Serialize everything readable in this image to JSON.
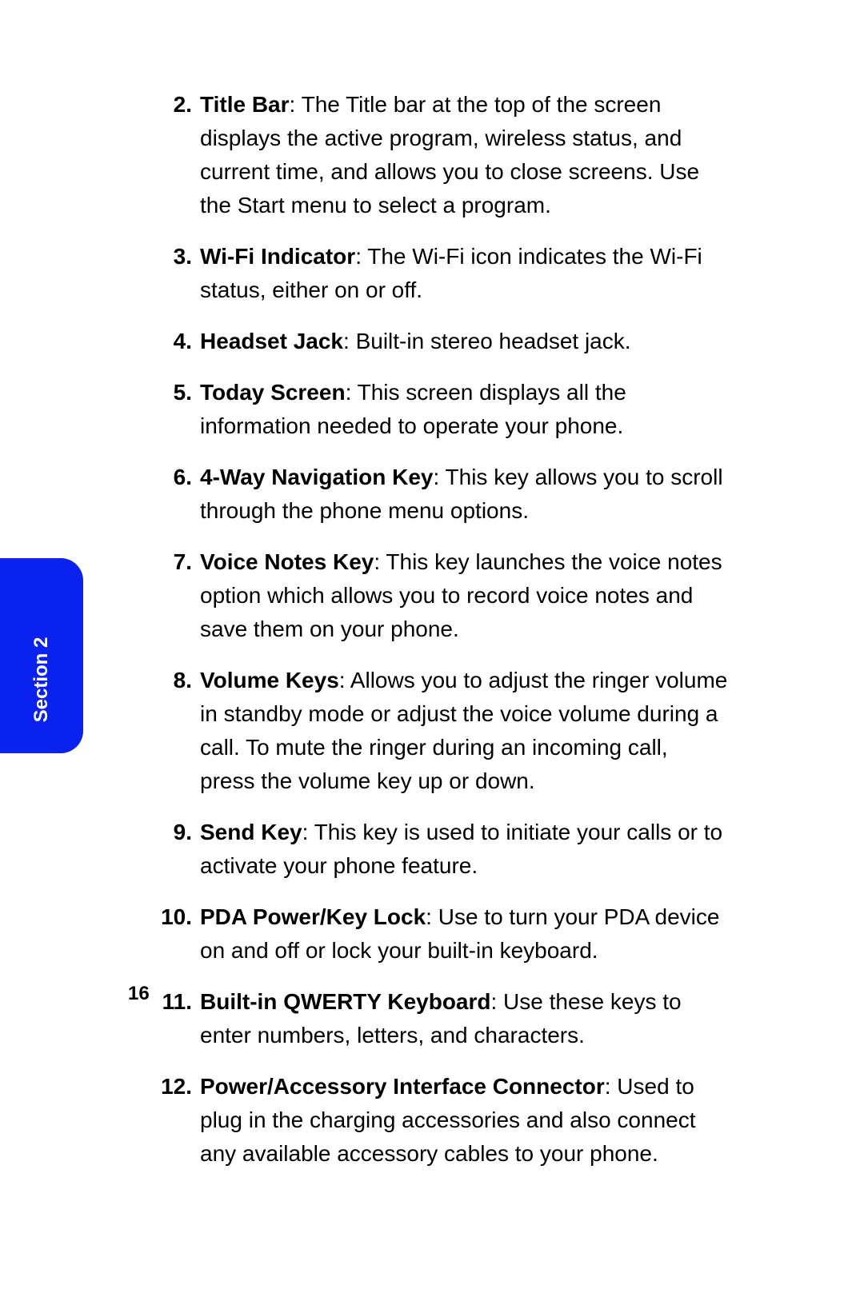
{
  "tab_label": "Section 2",
  "page_number": "16",
  "items": [
    {
      "num": "2.",
      "term": "Title Bar",
      "desc": ": The Title bar at the top of the screen displays the active program, wireless status, and current time, and allows you to close screens. Use the Start menu to select a program."
    },
    {
      "num": "3.",
      "term": "Wi-Fi Indicator",
      "desc": ": The Wi-Fi icon indicates the Wi-Fi status, either on or off."
    },
    {
      "num": "4.",
      "term": "Headset Jack",
      "desc": ": Built-in stereo headset jack."
    },
    {
      "num": "5.",
      "term": "Today Screen",
      "desc": ": This screen displays all the information needed to operate your phone."
    },
    {
      "num": "6.",
      "term": "4-Way Navigation Key",
      "desc": ": This key allows you to scroll through the phone menu options."
    },
    {
      "num": "7.",
      "term": "Voice Notes Key",
      "desc": ": This key launches the voice notes option which allows you to record voice notes and save them on your phone."
    },
    {
      "num": "8.",
      "term": "Volume Keys",
      "desc": ": Allows you to adjust the ringer volume in standby mode or adjust the voice volume during a call. To mute the ringer during an incoming call, press the volume key up or down."
    },
    {
      "num": "9.",
      "term": "Send Key",
      "desc": ": This key is used to initiate your calls or to activate your phone feature."
    },
    {
      "num": "10.",
      "term": "PDA Power/Key Lock",
      "desc": ": Use to turn your PDA device on and off or lock your built-in keyboard."
    },
    {
      "num": "11.",
      "term": "Built-in QWERTY Keyboard",
      "desc": ": Use these keys to enter numbers, letters, and characters."
    },
    {
      "num": "12.",
      "term": "Power/Accessory Interface Connector",
      "desc": ": Used to plug in the charging accessories and also connect any available accessory cables to your phone."
    }
  ]
}
